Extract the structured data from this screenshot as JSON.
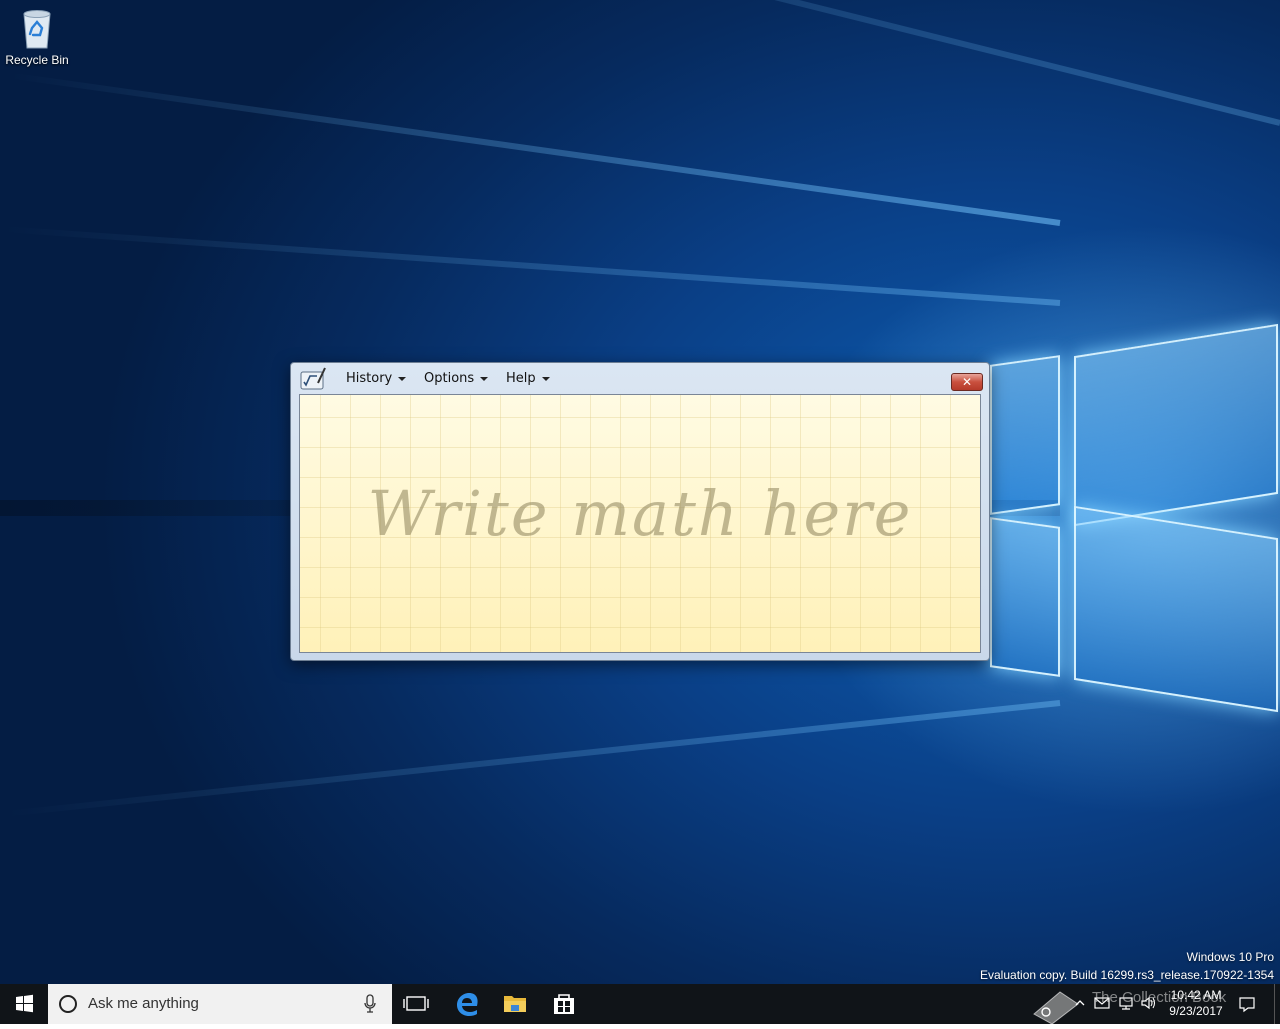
{
  "desktop": {
    "icons": [
      {
        "label": "Recycle Bin"
      }
    ],
    "watermark": {
      "line1": "Windows 10 Pro",
      "line2": "Evaluation copy. Build 16299.rs3_release.170922-1354"
    }
  },
  "math_input_panel": {
    "menus": [
      {
        "label": "History"
      },
      {
        "label": "Options"
      },
      {
        "label": "Help"
      }
    ],
    "close_glyph": "✕",
    "writing_area_hint": "Write math here"
  },
  "taskbar": {
    "search_placeholder": "Ask me anything",
    "pinned": [
      "task-view-icon",
      "edge-icon",
      "file-explorer-icon",
      "store-icon"
    ],
    "tray_overlay_text": "The Collection Book",
    "clock": {
      "time": "10:42 AM",
      "date": "9/23/2017"
    }
  }
}
